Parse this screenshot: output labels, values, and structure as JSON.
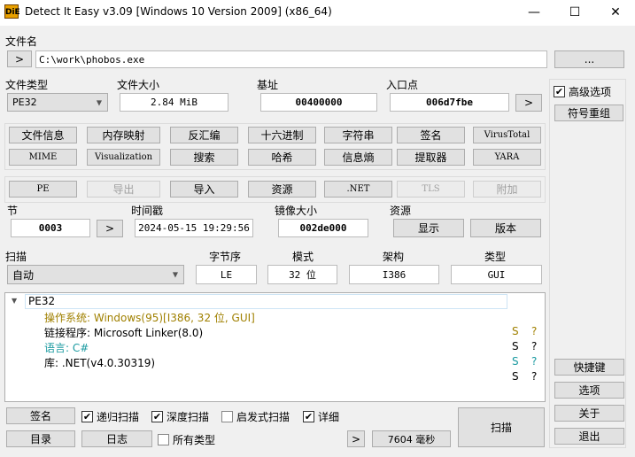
{
  "window": {
    "title": "Detect It Easy v3.09 [Windows 10 Version 2009] (x86_64)",
    "app_icon": "DiE",
    "minimize": "—",
    "maximize": "☐",
    "close": "✕"
  },
  "file": {
    "label": "文件名",
    "browse_prev": ">",
    "path": "C:\\work\\phobos.exe",
    "browse": "..."
  },
  "info": {
    "type_label": "文件类型",
    "type_value": "PE32",
    "size_label": "文件大小",
    "size_value": "2.84 MiB",
    "base_label": "基址",
    "base_value": "00400000",
    "entry_label": "入口点",
    "entry_value": "006d7fbe",
    "entry_go": ">"
  },
  "tools_row1": [
    "文件信息",
    "内存映射",
    "反汇编",
    "十六进制",
    "字符串",
    "签名",
    "VirusTotal"
  ],
  "tools_row2": [
    "MIME",
    "Visualization",
    "搜索",
    "哈希",
    "信息熵",
    "提取器",
    "YARA"
  ],
  "pe_row": [
    {
      "label": "PE",
      "enabled": true
    },
    {
      "label": "导出",
      "enabled": false
    },
    {
      "label": "导入",
      "enabled": true
    },
    {
      "label": "资源",
      "enabled": true
    },
    {
      "label": ".NET",
      "enabled": true
    },
    {
      "label": "TLS",
      "enabled": false
    },
    {
      "label": "附加",
      "enabled": false
    }
  ],
  "pe_info": {
    "section_label": "节",
    "section_value": "0003",
    "section_go": ">",
    "timestamp_label": "时间戳",
    "timestamp_value": "2024-05-15 19:29:56",
    "image_size_label": "镜像大小",
    "image_size_value": "002de000",
    "resources_label": "资源",
    "show": "显示",
    "version": "版本"
  },
  "scan": {
    "label": "扫描",
    "mode_value": "自动",
    "endian_label": "字节序",
    "endian_value": "LE",
    "bits_label": "模式",
    "bits_value": "32 位",
    "arch_label": "架构",
    "arch_value": "I386",
    "type_label": "类型",
    "type_value": "GUI"
  },
  "results": {
    "root": "PE32",
    "items": [
      {
        "text": "操作系统: Windows(95)[I386, 32 位, GUI]",
        "s": "S",
        "q": "?",
        "color": "#a08000"
      },
      {
        "text": "链接程序: Microsoft Linker(8.0)",
        "s": "S",
        "q": "?",
        "color": "#000000"
      },
      {
        "text": "语言: C#",
        "s": "S",
        "q": "?",
        "color": "#1a9aa0"
      },
      {
        "text": "库: .NET(v4.0.30319)",
        "s": "S",
        "q": "?",
        "color": "#000000"
      }
    ]
  },
  "bottom": {
    "signatures": "签名",
    "recursive": "递归扫描",
    "deep": "深度扫描",
    "heuristic": "启发式扫描",
    "verbose": "详细",
    "directory": "目录",
    "log": "日志",
    "all_types": "所有类型",
    "next": ">",
    "elapsed": "7604 毫秒",
    "scan": "扫描"
  },
  "side": {
    "advanced": "高级选项",
    "demangle": "符号重组",
    "shortcuts": "快捷键",
    "options": "选项",
    "about": "关于",
    "exit": "退出"
  }
}
